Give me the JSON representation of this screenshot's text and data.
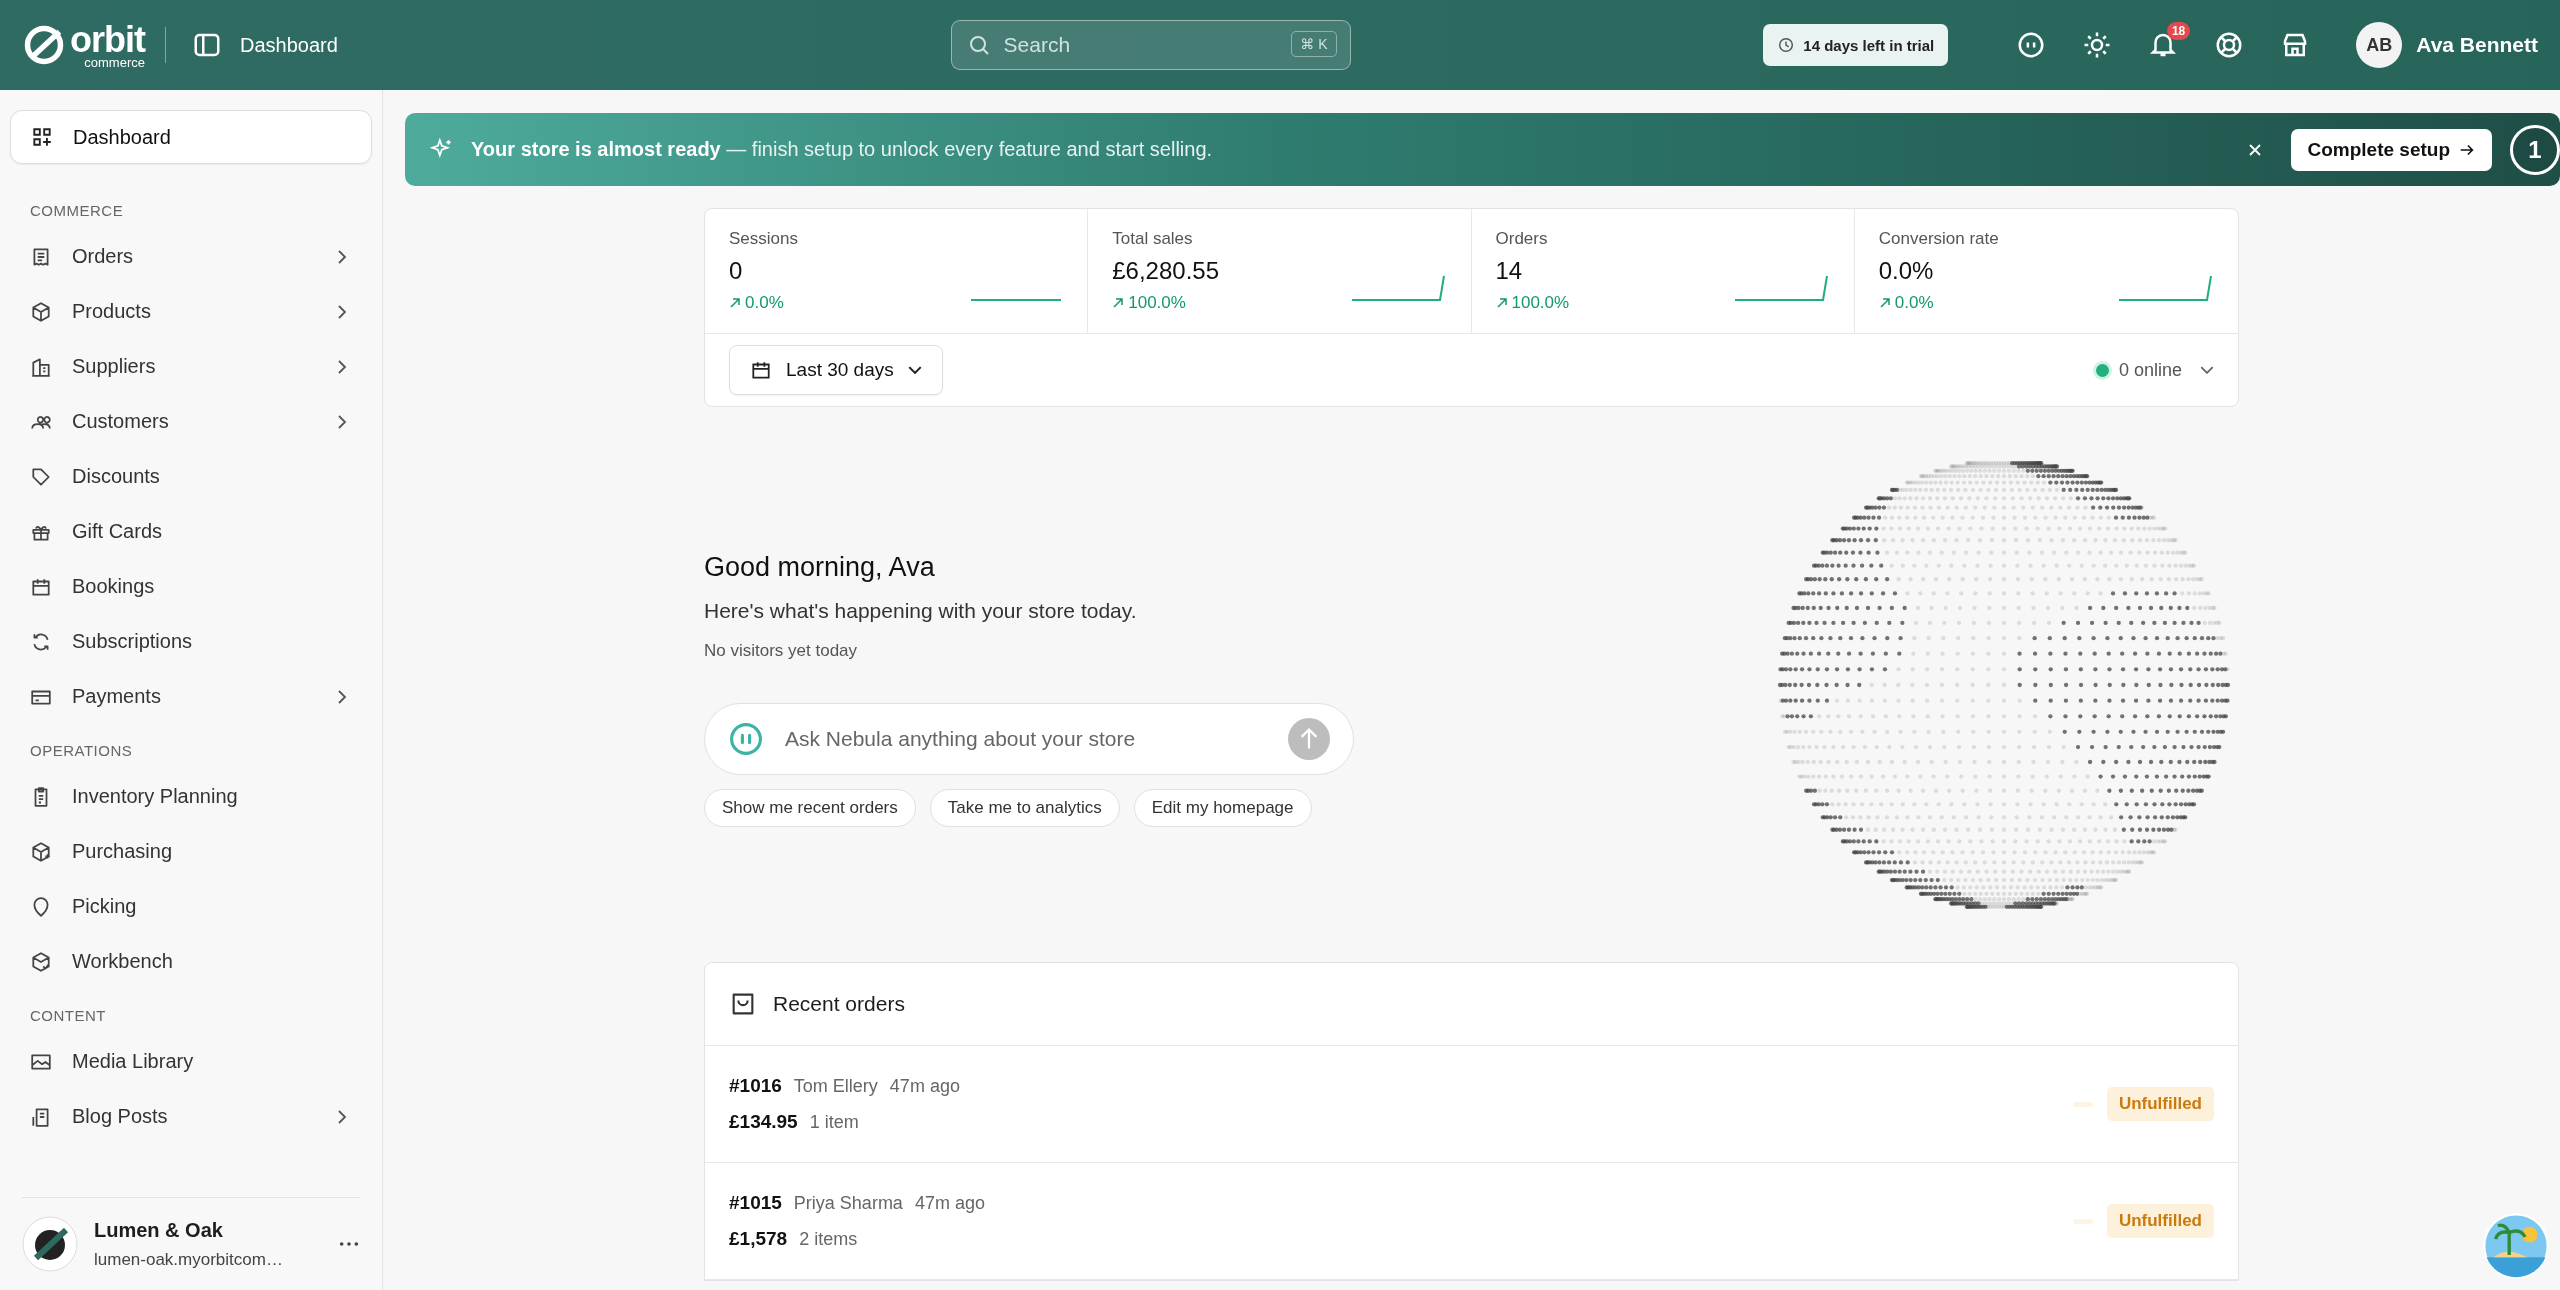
{
  "topbar": {
    "logo": {
      "name": "orbit",
      "tagline": "commerce"
    },
    "page_title": "Dashboard",
    "search": {
      "placeholder": "Search",
      "shortcut": "⌘ K"
    },
    "trial": "14 days left in trial",
    "notifications": "18",
    "user": {
      "initials": "AB",
      "name": "Ava Bennett"
    }
  },
  "sidebar": {
    "top_item": {
      "label": "Dashboard",
      "selected": true
    },
    "sections": [
      {
        "title": "COMMERCE",
        "items": [
          {
            "label": "Orders",
            "submenu": true,
            "selected": false
          },
          {
            "label": "Products",
            "submenu": true,
            "selected": false
          },
          {
            "label": "Suppliers",
            "submenu": true,
            "selected": false
          },
          {
            "label": "Customers",
            "submenu": true,
            "selected": false
          },
          {
            "label": "Discounts",
            "submenu": false,
            "selected": false
          },
          {
            "label": "Gift Cards",
            "submenu": false,
            "selected": false
          },
          {
            "label": "Bookings",
            "submenu": false,
            "selected": false
          },
          {
            "label": "Subscriptions",
            "submenu": false,
            "selected": false
          },
          {
            "label": "Payments",
            "submenu": true,
            "selected": false
          }
        ]
      },
      {
        "title": "OPERATIONS",
        "items": [
          {
            "label": "Inventory Planning",
            "submenu": false,
            "selected": false
          },
          {
            "label": "Purchasing",
            "submenu": false,
            "selected": false
          },
          {
            "label": "Picking",
            "submenu": false,
            "selected": false
          },
          {
            "label": "Workbench",
            "submenu": false,
            "selected": false
          }
        ]
      },
      {
        "title": "CONTENT",
        "items": [
          {
            "label": "Media Library",
            "submenu": false,
            "selected": false
          },
          {
            "label": "Blog Posts",
            "submenu": true,
            "selected": false
          }
        ]
      }
    ],
    "store": {
      "name": "Lumen & Oak",
      "domain": "lumen-oak.myorbitcom…"
    }
  },
  "banner": {
    "message": "**Your store is almost ready** — finish setup to unlock every feature and start selling.",
    "button": "Complete setup",
    "step": "1"
  },
  "stats": [
    {
      "label": "Sessions",
      "value": "0",
      "change": "0.0%"
    },
    {
      "label": "Total sales",
      "value": "£6,280.55",
      "change": "100.0%"
    },
    {
      "label": "Orders",
      "value": "14",
      "change": "100.0%"
    },
    {
      "label": "Conversion rate",
      "value": "0.0%",
      "change": "0.0%"
    }
  ],
  "date_range": "Last 30 days",
  "online": {
    "label": "0 online",
    "color": "#22b07d"
  },
  "greeting": {
    "title": "Good morning, Ava",
    "subtitle": "Here's what's happening with your store today.",
    "visitors": "No visitors yet today"
  },
  "assistant": {
    "placeholder": "Ask Nebula anything about your store",
    "suggestions": [
      "Show me recent orders",
      "Take me to analytics",
      "Edit my homepage"
    ]
  },
  "recent_orders": {
    "title": "Recent orders",
    "rows": [
      {
        "number": "#1016",
        "customer": "Tom Ellery",
        "time": "47m ago",
        "amount": "£134.95",
        "items": "1 item",
        "status": "Unfulfilled"
      },
      {
        "number": "#1015",
        "customer": "Priya Sharma",
        "time": "47m ago",
        "amount": "£1,578",
        "items": "2 items",
        "status": "Unfulfilled"
      }
    ]
  }
}
